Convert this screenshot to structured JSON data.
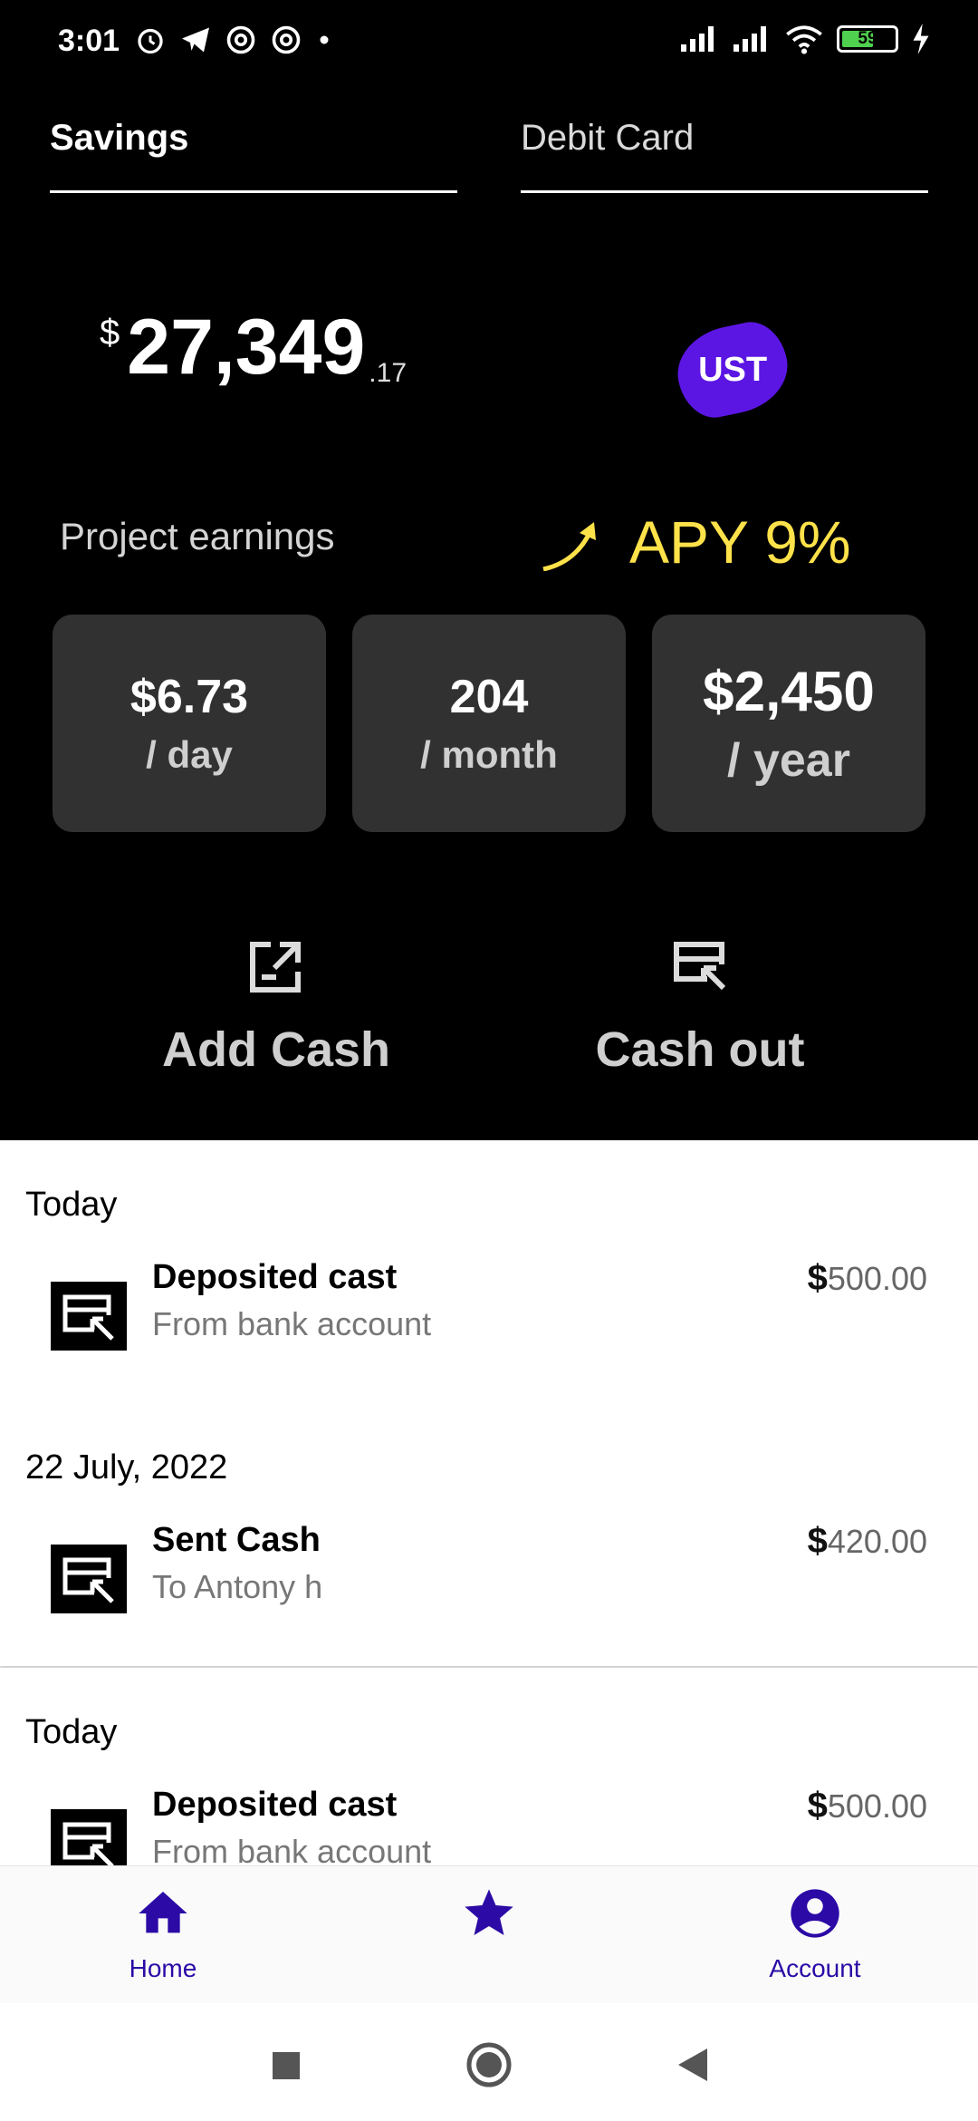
{
  "status_bar": {
    "time": "3:01",
    "battery": "59",
    "icons": [
      "alarm-icon",
      "telegram-icon",
      "at-icon",
      "at-icon",
      "dot-icon",
      "signal-icon",
      "signal-icon",
      "wifi-icon",
      "battery-icon",
      "charging-icon"
    ]
  },
  "tabs": [
    {
      "label": "Savings",
      "active": true
    },
    {
      "label": "Debit Card",
      "active": false
    }
  ],
  "balance": {
    "currency": "$",
    "main": "27,349",
    "cents": ".17"
  },
  "token_badge": "UST",
  "earnings": {
    "label": "Project earnings",
    "apy": "APY 9%",
    "stats": [
      {
        "value": "$6.73",
        "unit": "/ day"
      },
      {
        "value": "204",
        "unit": "/ month"
      },
      {
        "value": "$2,450",
        "unit": "/ year"
      }
    ]
  },
  "actions": {
    "add_cash": "Add Cash",
    "cash_out": "Cash out"
  },
  "transactions": [
    {
      "date": "Today",
      "title": "Deposited cast",
      "subtitle": "From bank account",
      "currency": "$",
      "amount": "500.00"
    },
    {
      "date": "22 July, 2022",
      "title": "Sent Cash",
      "subtitle": "To Antony h",
      "currency": "$",
      "amount": "420.00"
    },
    {
      "date": "Today",
      "title": "Deposited cast",
      "subtitle": "From bank account",
      "currency": "$",
      "amount": "500.00"
    }
  ],
  "bottom_nav": {
    "home": "Home",
    "favorites": "",
    "account": "Account"
  },
  "colors": {
    "accent": "#2b0aa6",
    "badge": "#5b16e3",
    "apy": "#ffe24a",
    "card": "#313131"
  }
}
